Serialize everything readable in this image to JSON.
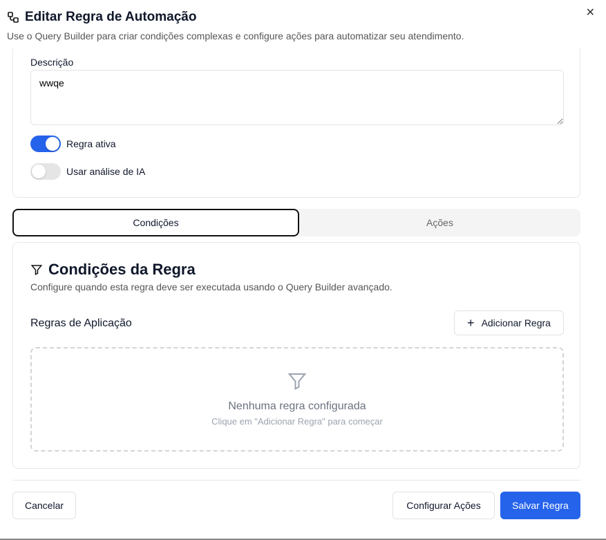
{
  "dialog": {
    "title": "Editar Regra de Automação",
    "subtitle": "Use o Query Builder para criar condições complexas e configure ações para automatizar seu atendimento."
  },
  "form": {
    "description_label": "Descrição",
    "description_value": "wwqe",
    "toggle_active_label": "Regra ativa",
    "toggle_active": true,
    "toggle_ai_label": "Usar análise de IA",
    "toggle_ai": false
  },
  "tabs": [
    {
      "label": "Condições",
      "active": true
    },
    {
      "label": "Ações",
      "active": false
    }
  ],
  "conditions": {
    "title": "Condições da Regra",
    "subtitle": "Configure quando esta regra deve ser executada usando o Query Builder avançado.",
    "rules_label": "Regras de Aplicação",
    "add_button": "Adicionar Regra",
    "empty_title": "Nenhuma regra configurada",
    "empty_hint": "Clique em \"Adicionar Regra\" para começar"
  },
  "footer": {
    "cancel": "Cancelar",
    "configure": "Configurar Ações",
    "save": "Salvar Regra"
  },
  "colors": {
    "primary": "#2563eb"
  }
}
